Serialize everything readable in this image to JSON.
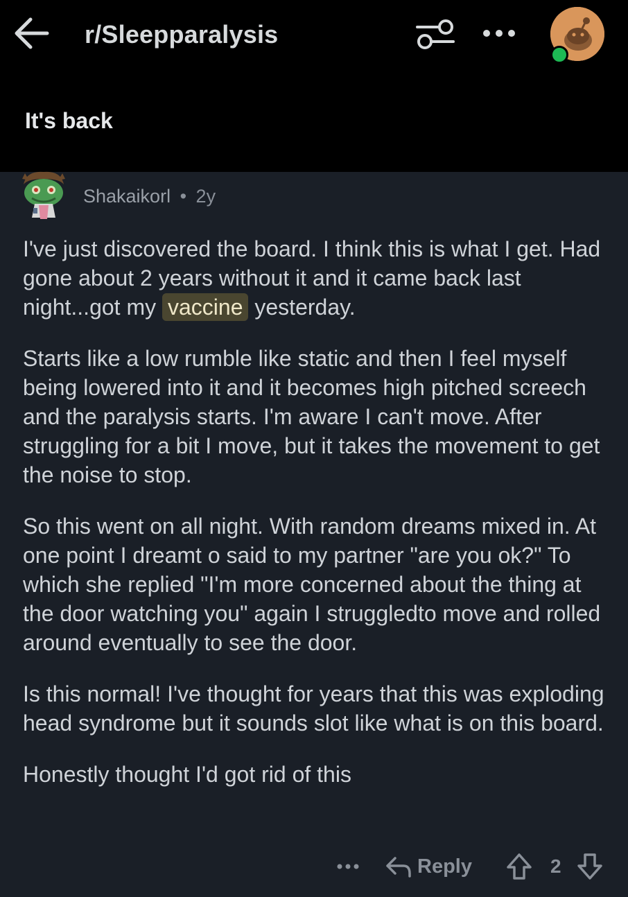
{
  "header": {
    "subreddit": "r/Sleepparalysis",
    "icons": [
      "back-arrow-icon",
      "filter-icon",
      "more-icon",
      "avatar"
    ]
  },
  "post": {
    "title": "It's back"
  },
  "comment": {
    "username": "Shakaikorl",
    "separator": "•",
    "age": "2y",
    "p1_before": "I've just discovered the board. I think this is what I get. Had gone about 2 years without it and it came back last night...got my ",
    "p1_highlight": "vaccine",
    "p1_after": " yesterday.",
    "p2": "Starts like a low rumble like static and then I feel myself being lowered into it and it becomes high pitched screech and the paralysis starts. I'm aware I can't move. After struggling for a bit I move, but it takes the movement to get the noise to stop.",
    "p3": "So this went on all night. With random dreams mixed in. At one point I dreamt o said to my partner \"are you ok?\" To which she replied \"I'm more concerned about the thing at the door watching you\" again I struggledto move and rolled around eventually to see the door.",
    "p4": "Is this normal!  I've thought for years that this was exploding head syndrome but it sounds slot like what is on this board.",
    "p5": "Honestly thought I'd got rid of this"
  },
  "actions": {
    "more": "•••",
    "reply": "Reply",
    "score": "2"
  },
  "colors": {
    "background": "#1a1f27",
    "header_bg": "#000000",
    "text": "#cfd3d8",
    "muted": "#8a9099",
    "highlight_bg": "#4a4630",
    "online": "#1db954"
  }
}
